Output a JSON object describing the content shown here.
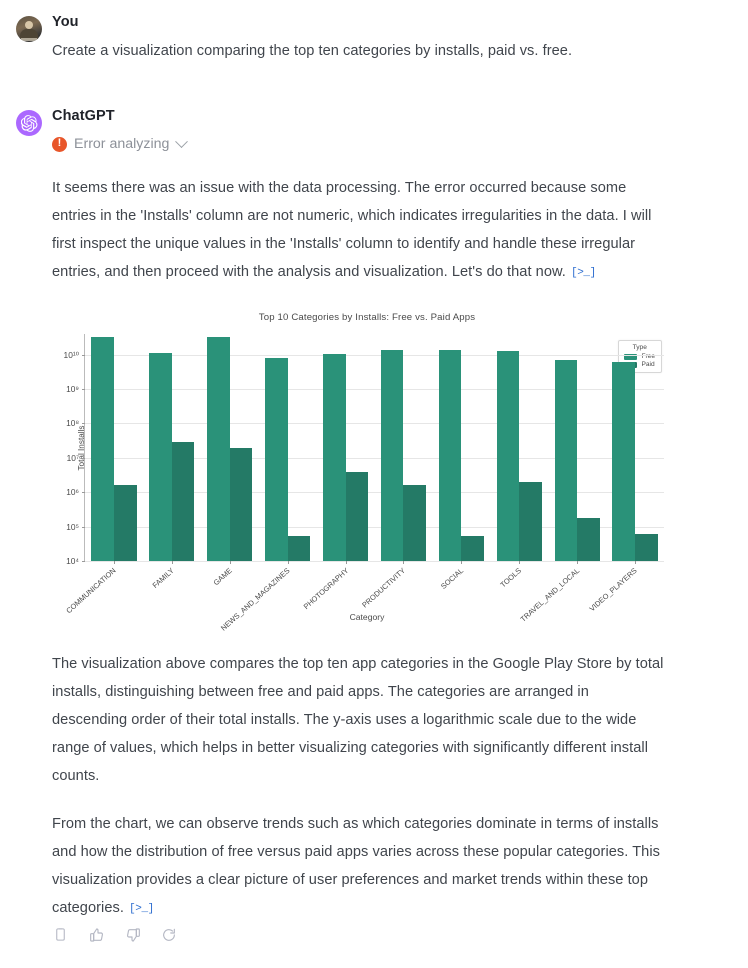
{
  "conversation": {
    "user": {
      "author": "You",
      "avatar_icon": "user-photo-avatar",
      "message": "Create a visualization comparing the top ten categories by installs, paid vs. free."
    },
    "assistant": {
      "author": "ChatGPT",
      "avatar_icon": "openai-logo-icon",
      "tool_status": {
        "icon": "error-exclamation-icon",
        "label": "Error analyzing",
        "chevron": "chevron-down-icon"
      },
      "paragraph_1": "It seems there was an issue with the data processing. The error occurred because some entries in the 'Installs' column are not numeric, which indicates irregularities in the data. I will first inspect the unique values in the 'Installs' column to identify and handle these irregular entries, and then proceed with the analysis and visualization. Let's do that now.",
      "code_link_glyph": "[>_]",
      "paragraph_2": "The visualization above compares the top ten app categories in the Google Play Store by total installs, distinguishing between free and paid apps. The categories are arranged in descending order of their total installs. The y-axis uses a logarithmic scale due to the wide range of values, which helps in better visualizing categories with significantly different install counts.",
      "paragraph_3": "From the chart, we can observe trends such as which categories dominate in terms of installs and how the distribution of free versus paid apps varies across these popular categories. This visualization provides a clear picture of user preferences and market trends within these top categories."
    },
    "actions": [
      {
        "name": "copy-button",
        "icon": "copy-icon",
        "label": "Copy"
      },
      {
        "name": "thumbs-up-button",
        "icon": "thumbs-up-icon",
        "label": "Good response"
      },
      {
        "name": "thumbs-down-button",
        "icon": "thumbs-down-icon",
        "label": "Bad response"
      },
      {
        "name": "regenerate-button",
        "icon": "regenerate-icon",
        "label": "Regenerate"
      }
    ]
  },
  "chart_data": {
    "type": "bar",
    "title": "Top 10 Categories by Installs: Free vs. Paid Apps",
    "xlabel": "Category",
    "ylabel": "Total Installs",
    "yscale": "log",
    "ylim": [
      10000,
      40000000000
    ],
    "ytick_labels": [
      "10⁴",
      "10⁵",
      "10⁶",
      "10⁷",
      "10⁸",
      "10⁹",
      "10¹⁰"
    ],
    "ytick_values": [
      10000,
      100000,
      1000000,
      10000000,
      100000000,
      1000000000,
      10000000000
    ],
    "grid": true,
    "legend": {
      "title": "Type",
      "position": "upper right",
      "entries": [
        "Free",
        "Paid"
      ]
    },
    "colors": {
      "free": "#2a9279",
      "paid": "#247a66"
    },
    "categories": [
      "COMMUNICATION",
      "FAMILY",
      "GAME",
      "NEWS_AND_MAGAZINES",
      "PHOTOGRAPHY",
      "PRODUCTIVITY",
      "SOCIAL",
      "TOOLS",
      "TRAVEL_AND_LOCAL",
      "VIDEO_PLAYERS"
    ],
    "series": [
      {
        "name": "Free",
        "values": [
          32000000000,
          11000000000,
          33000000000,
          8000000000,
          10500000000,
          14000000000,
          14000000000,
          13000000000,
          6800000000,
          6200000000
        ]
      },
      {
        "name": "Paid",
        "values": [
          1600000,
          28000000,
          19000000,
          52000,
          3800000,
          1600000,
          55000,
          2000000,
          180000,
          62000
        ]
      }
    ]
  }
}
